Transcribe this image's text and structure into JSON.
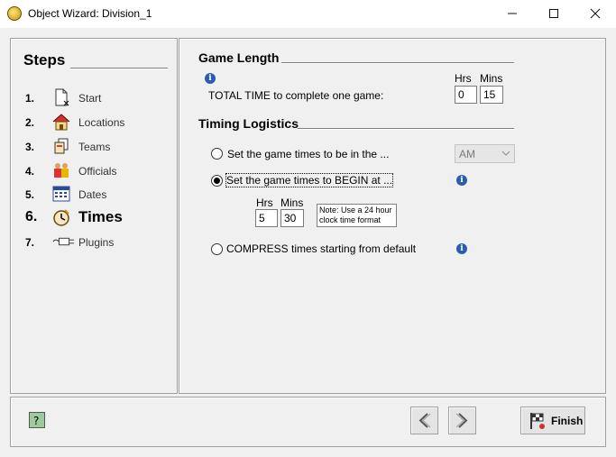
{
  "window": {
    "title": "Object Wizard: Division_1",
    "minimize_glyph": "—",
    "close_glyph": "✕"
  },
  "steps": {
    "title": "Steps",
    "items": [
      {
        "num": "1.",
        "label": "Start",
        "icon": "start-page-icon"
      },
      {
        "num": "2.",
        "label": "Locations",
        "icon": "house-icon"
      },
      {
        "num": "3.",
        "label": "Teams",
        "icon": "teams-icon"
      },
      {
        "num": "4.",
        "label": "Officials",
        "icon": "officials-icon"
      },
      {
        "num": "5.",
        "label": "Dates",
        "icon": "calendar-icon"
      },
      {
        "num": "6.",
        "label": "Times",
        "icon": "clock-icon",
        "active": true
      },
      {
        "num": "7.",
        "label": "Plugins",
        "icon": "plug-icon"
      }
    ]
  },
  "game_length": {
    "title": "Game Length",
    "hrs_label": "Hrs",
    "mins_label": "Mins",
    "total_time_label": "TOTAL TIME to complete one game:",
    "hrs_value": "0",
    "mins_value": "15"
  },
  "timing": {
    "title": "Timing Logistics",
    "option1_label": "Set the game times to be in the ...",
    "option1_dropdown": "AM",
    "option2_label": "Set the game times to BEGIN at ...",
    "option2_hrs_label": "Hrs",
    "option2_mins_label": "Mins",
    "option2_hrs_value": "5",
    "option2_mins_value": "30",
    "note_line1": "Note: Use a 24 hour",
    "note_line2": "clock time format",
    "option3_label": "COMPRESS times starting from default",
    "selected_option": 2
  },
  "footer": {
    "finish_label": "Finish"
  },
  "colors": {
    "info_blue": "#2a5db0",
    "background": "#f0f0f0"
  }
}
